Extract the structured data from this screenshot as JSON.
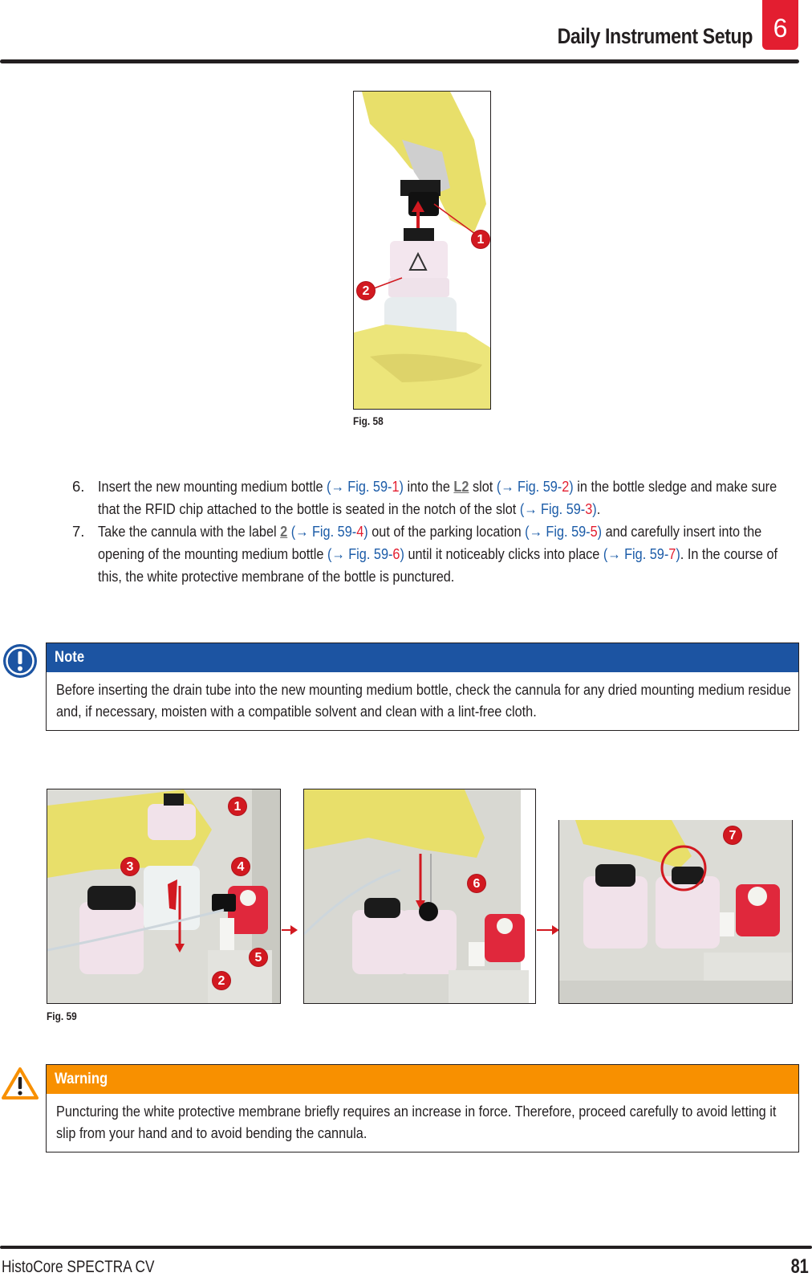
{
  "header": {
    "title": "Daily Instrument Setup",
    "chapter_number": "6",
    "chapter_color": "#e31e30"
  },
  "figure58": {
    "caption": "Fig.  58",
    "callouts": [
      "1",
      "2"
    ],
    "image_description": "Gloved hands removing black cap from mounting medium bottle with warning label"
  },
  "steps": [
    {
      "number": "6.",
      "segments": [
        {
          "t": "Insert the new mounting medium bottle "
        },
        {
          "t": "(→ Fig.  59-",
          "c": "ref"
        },
        {
          "t": "1",
          "c": "ref-num"
        },
        {
          "t": ")",
          "c": "ref"
        },
        {
          "t": " into the "
        },
        {
          "t": "L2",
          "c": "uline"
        },
        {
          "t": " slot "
        },
        {
          "t": "(→ Fig.  59-",
          "c": "ref"
        },
        {
          "t": "2",
          "c": "ref-num"
        },
        {
          "t": ")",
          "c": "ref"
        },
        {
          "t": " in the bottle sledge and make sure that the RFID chip attached to the bottle is seated in the notch of the slot "
        },
        {
          "t": "(→ Fig.  59-",
          "c": "ref"
        },
        {
          "t": "3",
          "c": "ref-num"
        },
        {
          "t": ")",
          "c": "ref"
        },
        {
          "t": "."
        }
      ]
    },
    {
      "number": "7.",
      "segments": [
        {
          "t": "Take the cannula with the label "
        },
        {
          "t": "2",
          "c": "uline"
        },
        {
          "t": " "
        },
        {
          "t": "(→ Fig.  59-",
          "c": "ref"
        },
        {
          "t": "4",
          "c": "ref-num"
        },
        {
          "t": ")",
          "c": "ref"
        },
        {
          "t": " out of the parking location "
        },
        {
          "t": "(→ Fig.  59-",
          "c": "ref"
        },
        {
          "t": "5",
          "c": "ref-num"
        },
        {
          "t": ")",
          "c": "ref"
        },
        {
          "t": " and carefully insert into the opening of the mounting medium bottle "
        },
        {
          "t": "(→ Fig.  59-",
          "c": "ref"
        },
        {
          "t": "6",
          "c": "ref-num"
        },
        {
          "t": ")",
          "c": "ref"
        },
        {
          "t": " until it noticeably clicks into place "
        },
        {
          "t": "(→ Fig.  59-",
          "c": "ref"
        },
        {
          "t": "7",
          "c": "ref-num"
        },
        {
          "t": ")",
          "c": "ref"
        },
        {
          "t": ". In the course of this, the white protective membrane of the bottle is punctured."
        }
      ]
    }
  ],
  "note": {
    "icon": "info-exclamation-circle-icon",
    "title": "Note",
    "color": "#1c54a2",
    "body": "Before inserting the drain tube into the new mounting medium bottle, check the cannula for any dried mounting medium residue and, if necessary, moisten with a compatible solvent and clean with a lint-free cloth."
  },
  "figure59": {
    "caption": "Fig.  59",
    "panels": [
      {
        "callouts": [
          "1",
          "2",
          "3",
          "4",
          "5"
        ],
        "image_description": "Inserting bottle into L2 slot"
      },
      {
        "callouts": [
          "6"
        ],
        "image_description": "Inserting cannula into bottle opening"
      },
      {
        "callouts": [
          "7"
        ],
        "image_description": "Cannula clicked into place"
      }
    ]
  },
  "warning": {
    "icon": "warning-triangle-icon",
    "title": "Warning",
    "color": "#f89000",
    "body": "Puncturing the white protective membrane briefly requires an increase in force. Therefore, proceed carefully to avoid letting it slip from your hand and to avoid bending the cannula."
  },
  "footer": {
    "product": "HistoCore SPECTRA CV",
    "page_number": "81"
  }
}
